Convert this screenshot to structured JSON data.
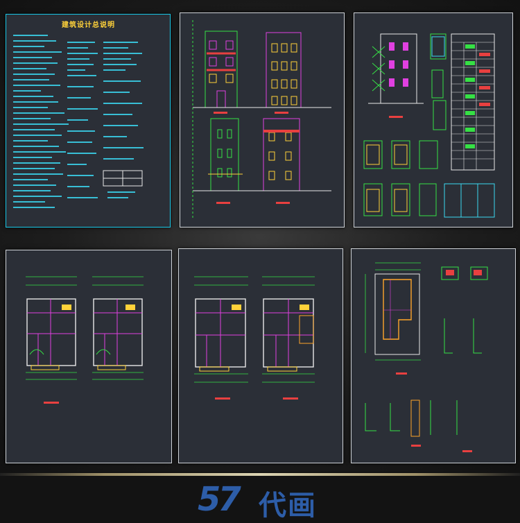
{
  "sheets": {
    "notes_title": "建筑设计总说明"
  },
  "logo": {
    "number": "57",
    "text": "代画"
  },
  "colors": {
    "background": "#131313",
    "sheet": "#2b2f37",
    "cyan": "#18c7e6",
    "yellow": "#ffd23a",
    "green": "#36e045",
    "magenta": "#e040e0",
    "logo_blue": "#2d5da8"
  }
}
